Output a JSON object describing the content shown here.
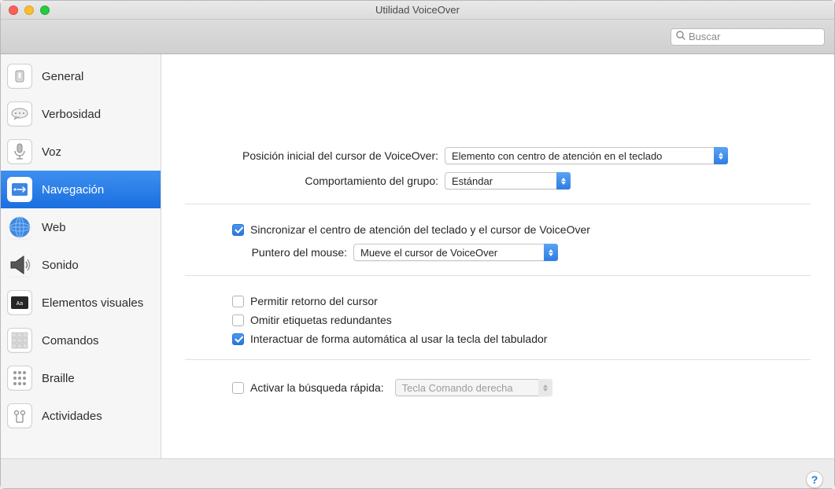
{
  "window": {
    "title": "Utilidad VoiceOver"
  },
  "toolbar": {
    "search_placeholder": "Buscar"
  },
  "sidebar": {
    "items": [
      {
        "id": "general",
        "label": "General"
      },
      {
        "id": "verbosity",
        "label": "Verbosidad"
      },
      {
        "id": "speech",
        "label": "Voz"
      },
      {
        "id": "nav",
        "label": "Navegación",
        "active": true
      },
      {
        "id": "web",
        "label": "Web"
      },
      {
        "id": "sound",
        "label": "Sonido"
      },
      {
        "id": "visuals",
        "label": "Elementos visuales"
      },
      {
        "id": "commands",
        "label": "Comandos"
      },
      {
        "id": "braille",
        "label": "Braille"
      },
      {
        "id": "activities",
        "label": "Actividades"
      }
    ]
  },
  "nav": {
    "initial_pos_label": "Posición inicial del cursor de VoiceOver:",
    "initial_pos_value": "Elemento con centro de atención en el teclado",
    "group_behavior_label": "Comportamiento del grupo:",
    "group_behavior_value": "Estándar",
    "sync_focus_label": "Sincronizar el centro de atención del teclado y el cursor de VoiceOver",
    "sync_focus_checked": true,
    "mouse_pointer_label": "Puntero del mouse:",
    "mouse_pointer_value": "Mueve el cursor de VoiceOver",
    "allow_cursor_return_label": "Permitir retorno del cursor",
    "allow_cursor_return_checked": false,
    "skip_redundant_label": "Omitir etiquetas redundantes",
    "skip_redundant_checked": false,
    "interact_tab_label": "Interactuar de forma automática al usar la tecla del tabulador",
    "interact_tab_checked": true,
    "quick_search_label": "Activar la búsqueda rápida:",
    "quick_search_checked": false,
    "quick_search_value": "Tecla Comando derecha"
  },
  "help": {
    "label": "?"
  }
}
